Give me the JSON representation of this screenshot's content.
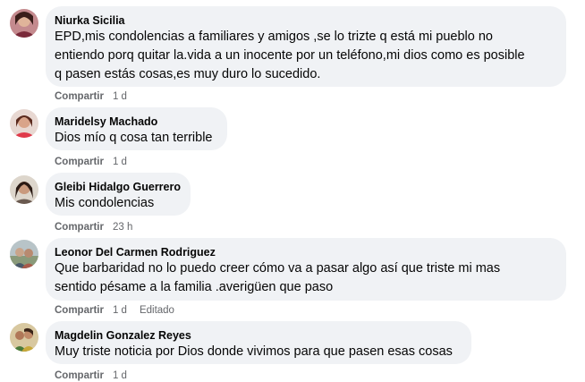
{
  "comments": [
    {
      "author": "Niurka Sicilia",
      "lines": [
        "EPD,mis condolencias a familiares y amigos ,se lo trizte q está mi pueblo no",
        "entiendo porq quitar la.vida a un inocente por un teléfono,mi dios como es posible",
        "q pasen estás cosas,es muy duro lo sucedido."
      ],
      "share_label": "Compartir",
      "time": "1 d",
      "edited": ""
    },
    {
      "author": "Maridelsy Machado",
      "lines": [
        "Dios mío q cosa tan terrible"
      ],
      "share_label": "Compartir",
      "time": "1 d",
      "edited": ""
    },
    {
      "author": "Gleibi Hidalgo Guerrero",
      "lines": [
        "Mis condolencias"
      ],
      "share_label": "Compartir",
      "time": "23 h",
      "edited": ""
    },
    {
      "author": "Leonor Del Carmen Rodriguez",
      "lines": [
        "Que barbaridad no lo puedo creer cómo va a pasar algo así que triste mi mas",
        "sentido pésame a la familia .averigüen que paso"
      ],
      "share_label": "Compartir",
      "time": "1 d",
      "edited": "Editado"
    },
    {
      "author": "Magdelin Gonzalez Reyes",
      "lines": [
        "Muy triste noticia por Dios donde vivimos para que pasen esas cosas"
      ],
      "share_label": "Compartir",
      "time": "1 d",
      "edited": ""
    }
  ],
  "colors": {
    "bubble": "#f0f2f5",
    "text": "#050505",
    "meta": "#65676b"
  }
}
